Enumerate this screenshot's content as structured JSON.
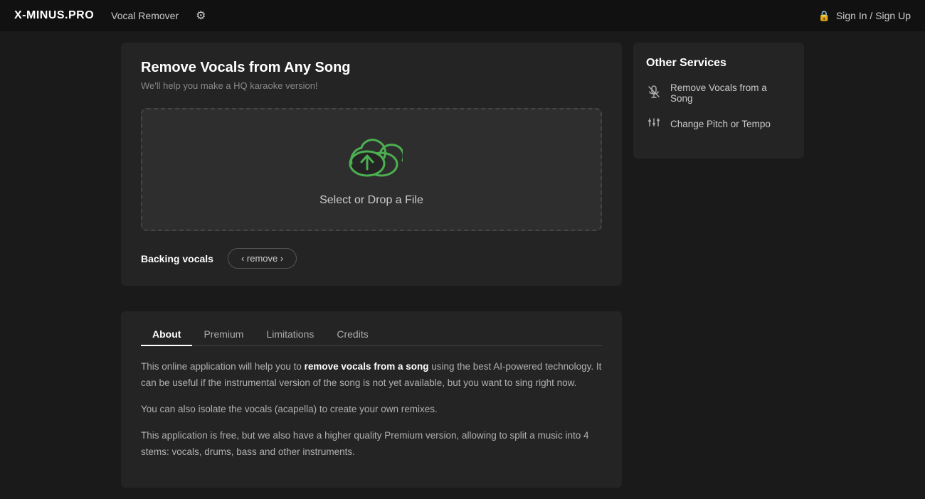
{
  "header": {
    "logo": "X-MINUS.PRO",
    "nav": "Vocal Remover",
    "sign_in_label": "Sign In / Sign Up"
  },
  "main_panel": {
    "title": "Remove Vocals from Any Song",
    "subtitle": "We'll help you make a HQ karaoke version!",
    "upload_text": "Select or Drop a File",
    "backing_vocals_label": "Backing vocals",
    "remove_btn_label": "‹ remove ›"
  },
  "tabs": {
    "items": [
      {
        "id": "about",
        "label": "About",
        "active": true
      },
      {
        "id": "premium",
        "label": "Premium",
        "active": false
      },
      {
        "id": "limitations",
        "label": "Limitations",
        "active": false
      },
      {
        "id": "credits",
        "label": "Credits",
        "active": false
      }
    ],
    "about_content": {
      "para1_pre": "This online application will help you to ",
      "para1_bold": "remove vocals from a song",
      "para1_post": " using the best AI-powered technology. It can be useful if the instrumental version of the song is not yet available, but you want to sing right now.",
      "para2": "You can also isolate the vocals (acapella) to create your own remixes.",
      "para3": "This application is free, but we also have a higher quality Premium version, allowing to split a music into 4 stems: vocals, drums, bass and other instruments."
    }
  },
  "right_panel": {
    "title": "Other Services",
    "services": [
      {
        "id": "remove-vocals",
        "label": "Remove Vocals from a Song",
        "icon": "mic_off"
      },
      {
        "id": "change-pitch",
        "label": "Change Pitch or Tempo",
        "icon": "tune"
      }
    ]
  }
}
